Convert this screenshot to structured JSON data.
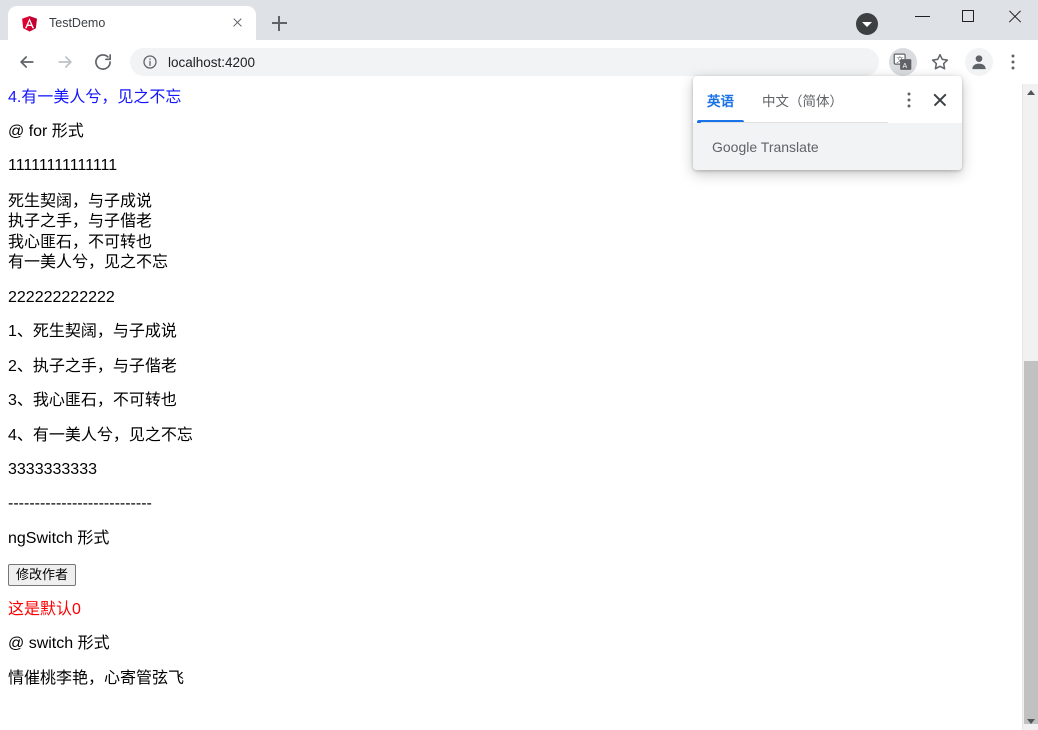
{
  "window": {
    "controls": {
      "tab_search": "tab-search",
      "minimize": "Minimize",
      "maximize": "Maximize",
      "close": "Close"
    }
  },
  "tabstrip": {
    "tabs": [
      {
        "title": "TestDemo",
        "favicon": "angular-logo",
        "close_label": "Close tab"
      }
    ],
    "new_tab_label": "New Tab"
  },
  "toolbar": {
    "back_label": "Back",
    "forward_label": "Forward",
    "reload_label": "Reload",
    "site_info_label": "View site information",
    "url": "localhost:4200",
    "url_host": "localhost",
    "url_port": ":4200",
    "translate_label": "Translate this page",
    "bookmark_label": "Bookmark this tab",
    "profile_label": "Profile",
    "menu_label": "Customize and control Google Chrome"
  },
  "translate_popup": {
    "tabs": [
      {
        "label": "英语",
        "active": true
      },
      {
        "label": "中文（简体）",
        "active": false
      }
    ],
    "options_label": "Translate options",
    "close_label": "Close",
    "footer": "Google Translate",
    "footer_brand": "Google",
    "footer_product": "Translate"
  },
  "page": {
    "blue_link": "4.有一美人兮，见之不忘",
    "for_heading": "@ for 形式",
    "ones": "11111111111111",
    "poem_lines": [
      "死生契阔，与子成说",
      "执子之手，与子偕老",
      "我心匪石，不可转也",
      "有一美人兮，见之不忘"
    ],
    "twos": "222222222222",
    "numbered_lines": [
      "1、死生契阔，与子成说",
      "2、执子之手，与子偕老",
      "3、我心匪石，不可转也",
      "4、有一美人兮，见之不忘"
    ],
    "threes": "3333333333",
    "divider": "---------------------------",
    "ngswitch_heading": "ngSwitch 形式",
    "change_author_button": "修改作者",
    "default_text": "这是默认0",
    "switch_heading": "@ switch 形式",
    "switch_result": "情催桃李艳，心寄管弦飞"
  },
  "scrollbar": {
    "up_label": "Scroll up",
    "down_label": "Scroll down",
    "thumb_label": "Vertical scrollbar"
  },
  "colors": {
    "link_blue": "#1414ff",
    "alert_red": "#ff0000",
    "chrome_accent": "#1a73e8",
    "tabstrip_bg": "#dee1e6"
  }
}
